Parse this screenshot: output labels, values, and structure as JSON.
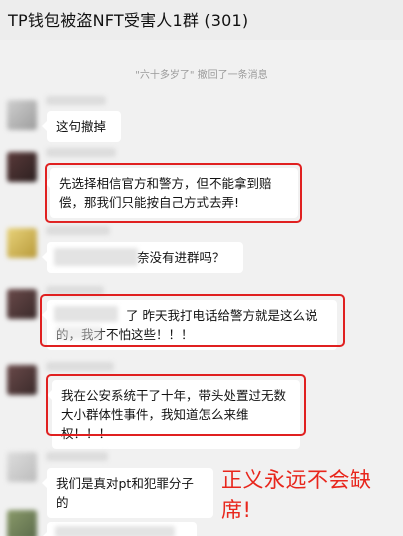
{
  "header": {
    "title": "TP钱包被盗NFT受害人1群 (301)"
  },
  "system_message": "\"六十多岁了\" 撤回了一条消息",
  "messages": [
    {
      "text": "这句撤掉"
    },
    {
      "text": "先选择相信官方和警方，但不能拿到赔偿，那我们只能按自己方式去弄!"
    },
    {
      "text": "奈没有进群吗？"
    },
    {
      "text": "了 昨天我打电话给警方就是这么说的，我才不怕这些！！！"
    },
    {
      "text": "我在公安系统干了十年，带头处置过无数大小群体性事件，我知道怎么来维权！！！"
    },
    {
      "text": "我们是真对pt和犯罪分子的"
    }
  ],
  "annotation": {
    "text": "正义永远不会缺席!",
    "color": "#e8261c"
  },
  "highlight_color": "#e02020"
}
